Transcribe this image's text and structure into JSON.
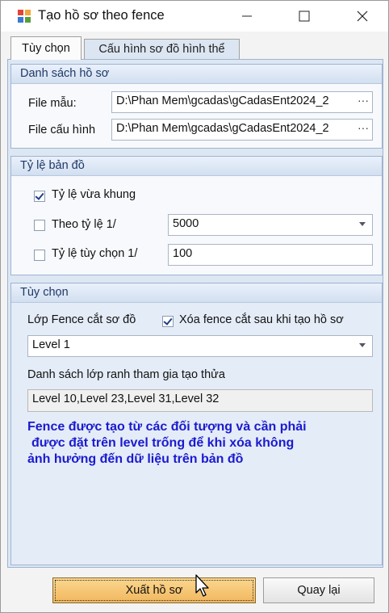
{
  "window": {
    "title": "Tạo hồ sơ theo fence"
  },
  "tabs": [
    {
      "label": "Tùy chọn",
      "active": true
    },
    {
      "label": "Cấu hình sơ đồ hình thể",
      "active": false
    }
  ],
  "profile_list": {
    "header": "Danh sách hồ sơ",
    "template_label": "File mẫu:",
    "template_value": "D:\\Phan Mem\\gcadas\\gCadasEnt2024_2",
    "config_label": "File cấu hình",
    "config_value": "D:\\Phan Mem\\gcadas\\gCadasEnt2024_2",
    "browse_label": "···"
  },
  "map_scale": {
    "header": "Tỷ lệ bản đồ",
    "fit_frame_label": "Tỷ lệ vừa khung",
    "fit_frame_checked": true,
    "by_scale_label": "Theo tỷ lệ 1/",
    "by_scale_checked": false,
    "by_scale_value": "5000",
    "custom_scale_label": "Tỷ lệ tùy chọn 1/",
    "custom_scale_checked": false,
    "custom_scale_value": "100"
  },
  "options": {
    "header": "Tùy chọn",
    "fence_layer_label": "Lớp Fence cắt sơ đồ",
    "delete_fence_label": "Xóa fence cắt sau khi tạo hồ sơ",
    "delete_fence_checked": true,
    "fence_layer_value": "Level 1",
    "boundary_layers_label": "Danh sách lớp ranh tham gia tạo thửa",
    "boundary_layers_value": "Level 10,Level 23,Level 31,Level 32",
    "note_line1": "Fence được tạo từ các đối tượng và cần phải",
    "note_line2": "được đặt trên level trống để khi xóa không",
    "note_line3": "ảnh hưởng đến dữ liệu trên bản đồ"
  },
  "buttons": {
    "export": "Xuất hồ sơ",
    "back": "Quay lại"
  },
  "colors": {
    "accent": "#1a1ad0",
    "export_button": "#f5c26b",
    "panel": "#dde7f4"
  }
}
